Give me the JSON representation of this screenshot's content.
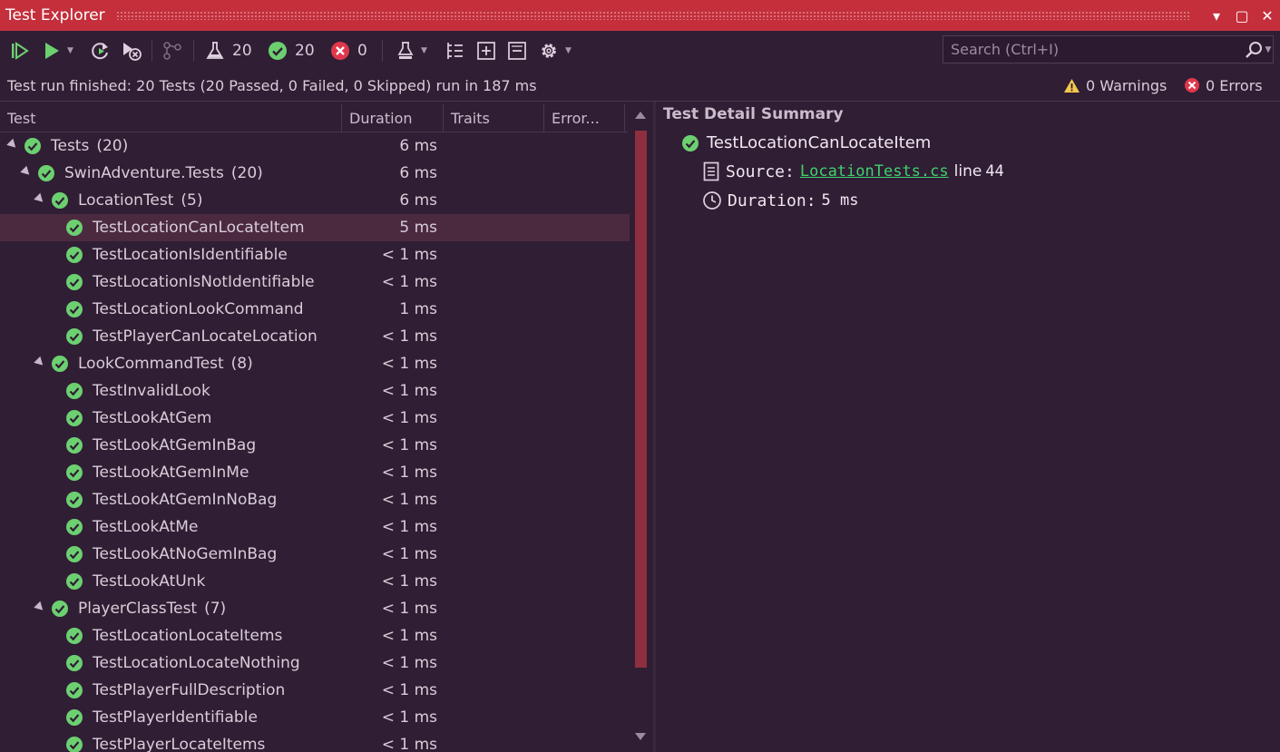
{
  "window": {
    "title": "Test Explorer",
    "dropdown_glyph": "▾",
    "restore_glyph": "▢",
    "close_glyph": "✕"
  },
  "toolbar": {
    "total_count": "20",
    "passed_count": "20",
    "failed_count": "0",
    "caret": "▼"
  },
  "search": {
    "placeholder": "Search (Ctrl+I)"
  },
  "status": {
    "summary": "Test run finished: 20 Tests (20 Passed, 0 Failed, 0 Skipped) run in 187 ms",
    "warnings": "0 Warnings",
    "errors": "0 Errors"
  },
  "columns": {
    "test": "Test",
    "duration": "Duration",
    "traits": "Traits",
    "error": "Error..."
  },
  "rows": [
    {
      "name": "Tests",
      "count": "(20)",
      "duration": "6 ms"
    },
    {
      "name": "SwinAdventure.Tests",
      "count": "(20)",
      "duration": "6 ms"
    },
    {
      "name": "LocationTest",
      "count": "(5)",
      "duration": "6 ms"
    },
    {
      "name": "TestLocationCanLocateItem",
      "count": "",
      "duration": "5 ms"
    },
    {
      "name": "TestLocationIsIdentifiable",
      "count": "",
      "duration": "< 1 ms"
    },
    {
      "name": "TestLocationIsNotIdentifiable",
      "count": "",
      "duration": "< 1 ms"
    },
    {
      "name": "TestLocationLookCommand",
      "count": "",
      "duration": "1 ms"
    },
    {
      "name": "TestPlayerCanLocateLocation",
      "count": "",
      "duration": "< 1 ms"
    },
    {
      "name": "LookCommandTest",
      "count": "(8)",
      "duration": "< 1 ms"
    },
    {
      "name": "TestInvalidLook",
      "count": "",
      "duration": "< 1 ms"
    },
    {
      "name": "TestLookAtGem",
      "count": "",
      "duration": "< 1 ms"
    },
    {
      "name": "TestLookAtGemInBag",
      "count": "",
      "duration": "< 1 ms"
    },
    {
      "name": "TestLookAtGemInMe",
      "count": "",
      "duration": "< 1 ms"
    },
    {
      "name": "TestLookAtGemInNoBag",
      "count": "",
      "duration": "< 1 ms"
    },
    {
      "name": "TestLookAtMe",
      "count": "",
      "duration": "< 1 ms"
    },
    {
      "name": "TestLookAtNoGemInBag",
      "count": "",
      "duration": "< 1 ms"
    },
    {
      "name": "TestLookAtUnk",
      "count": "",
      "duration": "< 1 ms"
    },
    {
      "name": "PlayerClassTest",
      "count": "(7)",
      "duration": "< 1 ms"
    },
    {
      "name": "TestLocationLocateItems",
      "count": "",
      "duration": "< 1 ms"
    },
    {
      "name": "TestLocationLocateNothing",
      "count": "",
      "duration": "< 1 ms"
    },
    {
      "name": "TestPlayerFullDescription",
      "count": "",
      "duration": "< 1 ms"
    },
    {
      "name": "TestPlayerIdentifiable",
      "count": "",
      "duration": "< 1 ms"
    },
    {
      "name": "TestPlayerLocateItems",
      "count": "",
      "duration": "< 1 ms"
    }
  ],
  "detail": {
    "header": "Test Detail Summary",
    "test_name": "TestLocationCanLocateItem",
    "source_label": "Source:",
    "source_file": "LocationTests.cs",
    "line_word": "line",
    "line_number": "44",
    "duration_label": "Duration:",
    "duration_value": "5 ms"
  },
  "colors": {
    "titlebar": "#c42f3b",
    "background": "#301e34",
    "passed": "#6cd071",
    "failed": "#e0374b",
    "warning": "#f2c94c",
    "link": "#3fd16f",
    "selected_row": "#4b2a40",
    "scroll_thumb": "#8d2f3f"
  }
}
